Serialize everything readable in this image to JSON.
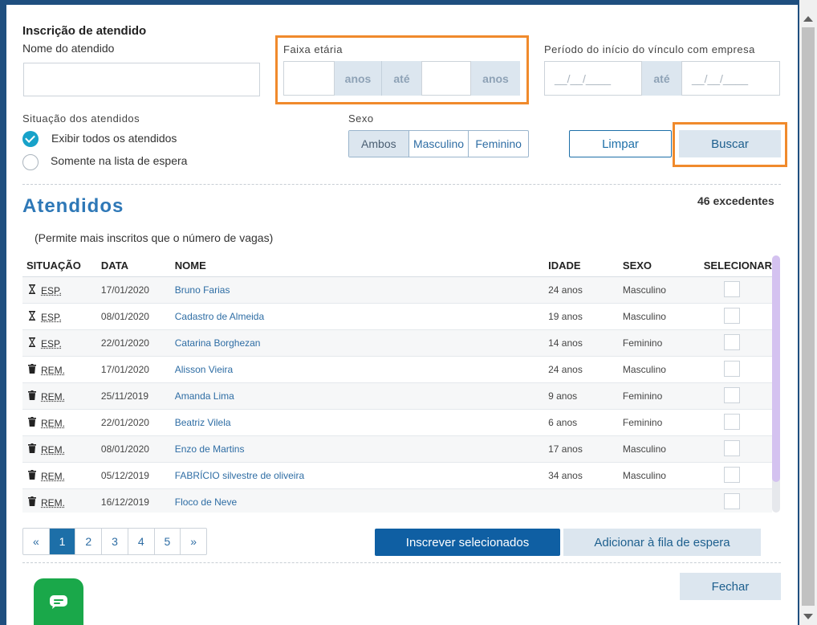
{
  "form": {
    "section_title": "Inscrição de atendido",
    "name_label": "Nome do atendido",
    "name_value": "",
    "age_label": "Faixa etária",
    "age_from": "",
    "age_unit_1": "anos",
    "age_between": "até",
    "age_to": "",
    "age_unit_2": "anos",
    "period_label": "Período do início do vínculo com empresa",
    "period_start_placeholder": "__/__/____",
    "period_between": "até",
    "period_end_placeholder": "__/__/____",
    "situation_label": "Situação dos atendidos",
    "situation_options": [
      "Exibir todos os atendidos",
      "Somente na lista de espera"
    ],
    "situation_selected": "Exibir todos os atendidos",
    "sex_label": "Sexo",
    "sex_options": [
      "Ambos",
      "Masculino",
      "Feminino"
    ],
    "sex_selected": "Ambos",
    "clear_button": "Limpar",
    "search_button": "Buscar"
  },
  "list": {
    "title": "Atendidos",
    "excess": "46 excedentes",
    "note": "(Permite mais inscritos que o número de vagas)",
    "columns": [
      "SITUAÇÃO",
      "DATA",
      "NOME",
      "IDADE",
      "SEXO",
      "SELECIONAR"
    ],
    "rows": [
      {
        "icon": "hourglass-icon",
        "status": "ESP.",
        "date": "17/01/2020",
        "name": "Bruno Farias",
        "age": "24 anos",
        "sex": "Masculino"
      },
      {
        "icon": "hourglass-icon",
        "status": "ESP.",
        "date": "08/01/2020",
        "name": "Cadastro de Almeida",
        "age": "19 anos",
        "sex": "Masculino"
      },
      {
        "icon": "hourglass-icon",
        "status": "ESP.",
        "date": "22/01/2020",
        "name": "Catarina Borghezan",
        "age": "14 anos",
        "sex": "Feminino"
      },
      {
        "icon": "trash-icon",
        "status": "REM.",
        "date": "17/01/2020",
        "name": "Alisson Vieira",
        "age": "24 anos",
        "sex": "Masculino"
      },
      {
        "icon": "trash-icon",
        "status": "REM.",
        "date": "25/11/2019",
        "name": "Amanda Lima",
        "age": "9 anos",
        "sex": "Feminino"
      },
      {
        "icon": "trash-icon",
        "status": "REM.",
        "date": "22/01/2020",
        "name": "Beatriz Vilela",
        "age": "6 anos",
        "sex": "Feminino"
      },
      {
        "icon": "trash-icon",
        "status": "REM.",
        "date": "08/01/2020",
        "name": "Enzo de Martins",
        "age": "17 anos",
        "sex": "Masculino"
      },
      {
        "icon": "trash-icon",
        "status": "REM.",
        "date": "05/12/2019",
        "name": "FABRÍCIO silvestre de oliveira",
        "age": "34 anos",
        "sex": "Masculino"
      },
      {
        "icon": "trash-icon",
        "status": "REM.",
        "date": "16/12/2019",
        "name": "Floco de Neve",
        "age": "",
        "sex": ""
      }
    ]
  },
  "pagination": {
    "prev": "«",
    "pages": [
      "1",
      "2",
      "3",
      "4",
      "5"
    ],
    "current": "1",
    "next": "»"
  },
  "actions": {
    "enroll_button": "Inscrever selecionados",
    "waitlist_button": "Adicionar à fila de espera",
    "close_button": "Fechar"
  },
  "colors": {
    "accent": "#2e78b7",
    "highlight": "#f08a2c",
    "primary_button": "#0f5fa3",
    "chat_button": "#1aa84a",
    "radio_checked": "#17a2c9",
    "table_scroll_thumb": "#d4c2f0"
  },
  "icons": {
    "chat": "chat-icon",
    "hourglass": "hourglass-icon",
    "trash": "trash-icon"
  }
}
